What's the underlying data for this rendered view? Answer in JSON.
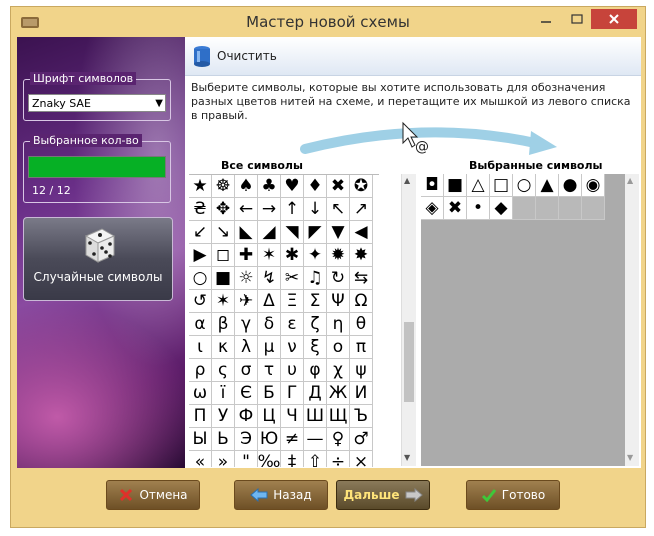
{
  "window": {
    "title": "Мастер новой схемы"
  },
  "sidebar": {
    "font_group_label": "Шрифт символов",
    "font_value": "Znaky SAE",
    "count_group_label": "Выбранное кол-во",
    "progress_fraction": 1.0,
    "count_text": "12 / 12",
    "random_button_label": "Случайные символы"
  },
  "toolbar": {
    "clear_label": "Очистить"
  },
  "instruction": "Выберите символы, которые вы хотите использовать для обозначения разных цветов нитей на схеме, и перетащите их мышкой из левого списка в правый.",
  "all_symbols": {
    "header": "Все символы",
    "rows": [
      [
        "★",
        "☸",
        "♠",
        "♣",
        "♥",
        "♦",
        "✖",
        "✪"
      ],
      [
        "₴",
        "✥",
        "←",
        "→",
        "↑",
        "↓",
        "↖",
        "↗"
      ],
      [
        "↙",
        "↘",
        "◣",
        "◢",
        "◥",
        "◤",
        "▼",
        "◀"
      ],
      [
        "▶",
        "◻",
        "✚",
        "✶",
        "✱",
        "✦",
        "✹",
        "✸"
      ],
      [
        "○",
        "■",
        "☼",
        "↯",
        "✂",
        "♫",
        "↻",
        "⇆"
      ],
      [
        "↺",
        "✶",
        "✈",
        "Δ",
        "Ξ",
        "Σ",
        "Ψ",
        "Ω"
      ],
      [
        "α",
        "β",
        "γ",
        "δ",
        "ε",
        "ζ",
        "η",
        "θ"
      ],
      [
        "ι",
        "κ",
        "λ",
        "μ",
        "ν",
        "ξ",
        "ο",
        "π"
      ],
      [
        "ρ",
        "ς",
        "σ",
        "τ",
        "υ",
        "φ",
        "χ",
        "ψ"
      ],
      [
        "ω",
        "ї",
        "Є",
        "Б",
        "Г",
        "Д",
        "Ж",
        "И"
      ],
      [
        "П",
        "У",
        "Ф",
        "Ц",
        "Ч",
        "Ш",
        "Щ",
        "Ъ"
      ],
      [
        "Ы",
        "Ь",
        "Э",
        "Ю",
        "≠",
        "—",
        "♀",
        "♂"
      ],
      [
        "«",
        "»",
        "\"",
        "‰",
        "‡",
        "⇧",
        "÷",
        "×"
      ]
    ]
  },
  "selected_symbols": {
    "header": "Выбранные символы",
    "items": [
      "◘",
      "■",
      "△",
      "□",
      "○",
      "▲",
      "●",
      "◉",
      "◈",
      "✖",
      "•",
      "◆"
    ]
  },
  "buttons": {
    "cancel": "Отмена",
    "back": "Назад",
    "next": "Дальше",
    "done": "Готово"
  }
}
